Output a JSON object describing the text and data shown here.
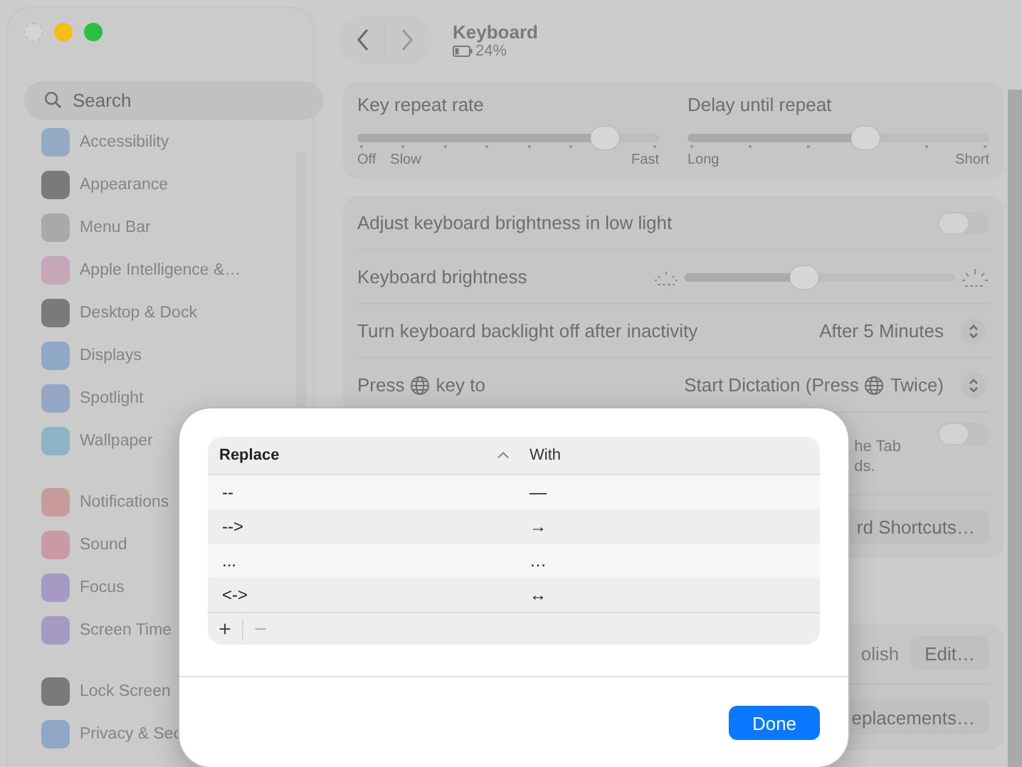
{
  "sidebar": {
    "search": {
      "placeholder": "Search"
    },
    "groups": [
      [
        {
          "label": "Accessibility",
          "color": "#93a9c4"
        },
        {
          "label": "Appearance",
          "color": "#7a7a7a"
        },
        {
          "label": "Menu Bar",
          "color": "#a9a9a9"
        },
        {
          "label": "Apple Intelligence &…",
          "color": "#c6a7b9"
        },
        {
          "label": "Desktop & Dock",
          "color": "#7a7a7a"
        },
        {
          "label": "Displays",
          "color": "#8fa8c6"
        },
        {
          "label": "Spotlight",
          "color": "#93a7c4"
        },
        {
          "label": "Wallpaper",
          "color": "#8db4c4"
        }
      ],
      [
        {
          "label": "Notifications",
          "color": "#c99a9a"
        },
        {
          "label": "Sound",
          "color": "#c99aa4"
        },
        {
          "label": "Focus",
          "color": "#a69ac4"
        },
        {
          "label": "Screen Time",
          "color": "#a69ac4"
        }
      ],
      [
        {
          "label": "Lock Screen",
          "color": "#7a7a7a"
        },
        {
          "label": "Privacy & Sec",
          "color": "#8fa6c6"
        }
      ]
    ]
  },
  "header": {
    "title": "Keyboard",
    "battery": "24%"
  },
  "repeat_sliders": [
    {
      "label": "Key repeat rate",
      "level": 0.82,
      "low_labels": [
        "Off",
        "Slow"
      ],
      "high_label": "Fast"
    },
    {
      "label": "Delay until repeat",
      "level": 0.59,
      "low_labels": [
        "Long"
      ],
      "high_label": "Short"
    }
  ],
  "settings": [
    {
      "kind": "toggle",
      "label": "Adjust keyboard brightness in low light",
      "on": false
    },
    {
      "kind": "slider",
      "label": "Keyboard brightness",
      "level": 0.44
    },
    {
      "kind": "popup",
      "label": "Turn keyboard backlight off after inactivity",
      "value": "After 5 Minutes"
    },
    {
      "kind": "globe_popup",
      "label_before": "Press",
      "label_after": "key to",
      "value_before": "Start Dictation (Press",
      "value_after": "Twice)"
    }
  ],
  "partly_hidden": [
    {
      "kind": "toggle",
      "on": false,
      "lines": [
        "he Tab",
        "ds."
      ]
    },
    {
      "kind": "button",
      "label": "rd Shortcuts…"
    }
  ],
  "partly_hidden_card": [
    {
      "kind": "value_button",
      "value": "olish",
      "button": "Edit…"
    },
    {
      "kind": "button",
      "label": "eplacements…"
    }
  ],
  "sheet": {
    "columns": [
      {
        "label": "Replace",
        "sorted": true
      },
      {
        "label": "With",
        "sorted": false
      }
    ],
    "rows": [
      {
        "replace": "--",
        "with": "—"
      },
      {
        "replace": "-->",
        "with": "→"
      },
      {
        "replace": "...",
        "with": "…"
      },
      {
        "replace": "<->",
        "with": "↔"
      }
    ],
    "add": "+",
    "remove": "−",
    "done": "Done"
  }
}
